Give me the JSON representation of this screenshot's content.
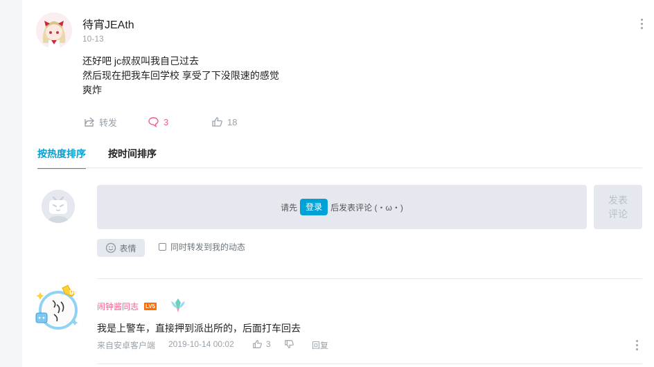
{
  "post": {
    "username": "待宵JEAth",
    "date": "10-13",
    "content_lines": [
      "还好吧 jc叔叔叫我自己过去",
      "然后现在把我车回学校 享受了下没限速的感觉",
      "爽炸"
    ],
    "share_label": "转发",
    "comment_count": "3",
    "like_count": "18"
  },
  "tabs": {
    "hot": "按热度排序",
    "time": "按时间排序"
  },
  "composer": {
    "prompt_before": "请先",
    "login_label": "登录",
    "prompt_after": "后发表评论 (・ω・)",
    "submit_line1": "发表",
    "submit_line2": "评论",
    "emoji_label": "表情",
    "repost_label": "同时转发到我的动态"
  },
  "comment": {
    "username": "闹钟酱同志",
    "level": "LV5",
    "text": "我是上警车，直接押到派出所的，后面打车回去",
    "source": "来自安卓客户端",
    "time": "2019-10-14 00:02",
    "like_count": "3",
    "reply_label": "回复"
  },
  "colors": {
    "accent": "#00a1d6",
    "pink": "#f25d8e",
    "muted": "#99a2aa",
    "input_bg": "#e5e9ef"
  }
}
